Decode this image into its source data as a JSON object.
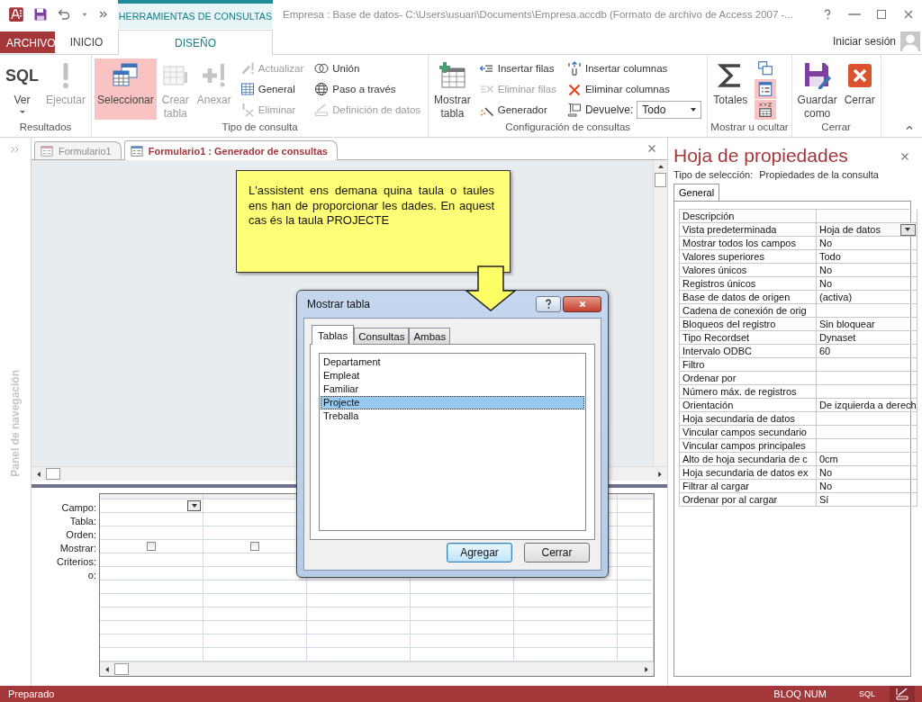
{
  "title_bar": {
    "context_tab": "HERRAMIENTAS DE CONSULTAS",
    "title": "Empresa : Base de datos- C:\\Users\\usuari\\Documents\\Empresa.accdb (Formato de archivo de Access 2007 -..."
  },
  "ribbon_tabs": [
    {
      "label": "ARCHIVO",
      "kind": "file",
      "selected": false
    },
    {
      "label": "INICIO",
      "kind": "tab",
      "selected": false
    },
    {
      "label": "DISEÑO",
      "kind": "tab",
      "selected": true
    }
  ],
  "account": {
    "label": "Iniciar sesión"
  },
  "ribbon": {
    "groups": [
      {
        "label": "Resultados",
        "items": [
          {
            "kind": "split",
            "icon_text": "SQL",
            "label": "Ver",
            "disabled": false,
            "selected": false
          },
          {
            "kind": "large",
            "label": "Ejecutar",
            "disabled": true,
            "selected": false
          }
        ]
      },
      {
        "label": "Tipo de consulta",
        "items": [
          {
            "kind": "large",
            "label": "Seleccionar",
            "disabled": false,
            "selected": true
          },
          {
            "kind": "large",
            "label": "Crear tabla",
            "disabled": true,
            "selected": false
          },
          {
            "kind": "large",
            "label": "Anexar",
            "disabled": true,
            "selected": false
          },
          {
            "kind": "column",
            "buttons": [
              {
                "kind": "small",
                "label": "Actualizar",
                "disabled": true,
                "selected": false
              },
              {
                "kind": "small",
                "label": "General",
                "disabled": false,
                "selected": false
              },
              {
                "kind": "small",
                "label": "Eliminar",
                "disabled": true,
                "selected": false
              }
            ]
          },
          {
            "kind": "column",
            "buttons": [
              {
                "kind": "small",
                "label": "Unión",
                "disabled": false,
                "selected": false
              },
              {
                "kind": "small",
                "label": "Paso a través",
                "disabled": false,
                "selected": false
              },
              {
                "kind": "small",
                "label": "Definición de datos",
                "disabled": true,
                "selected": false
              }
            ]
          }
        ]
      },
      {
        "label": "Configuración de consultas",
        "items": [
          {
            "kind": "large",
            "label": "Mostrar tabla",
            "disabled": false,
            "selected": false
          },
          {
            "kind": "column",
            "buttons": [
              {
                "kind": "small",
                "label": "Insertar filas",
                "disabled": false,
                "selected": false
              },
              {
                "kind": "small",
                "label": "Eliminar filas",
                "disabled": true,
                "selected": false
              },
              {
                "kind": "small",
                "label": "Generador",
                "disabled": false,
                "selected": false
              }
            ]
          },
          {
            "kind": "column",
            "buttons": [
              {
                "kind": "small",
                "label": "Insertar columnas",
                "disabled": false,
                "selected": false
              },
              {
                "kind": "small",
                "label": "Eliminar columnas",
                "disabled": false,
                "selected": false
              },
              {
                "kind": "select",
                "label": "Devuelve:",
                "value": "Todo",
                "disabled": false,
                "selected": false
              }
            ]
          }
        ]
      },
      {
        "label": "Mostrar u ocultar",
        "items": [
          {
            "kind": "large",
            "label": "Totales",
            "disabled": false,
            "selected": false
          },
          {
            "kind": "column",
            "buttons": [
              {
                "kind": "icon",
                "disabled": false,
                "selected": false
              },
              {
                "kind": "icon",
                "disabled": false,
                "selected": true
              },
              {
                "kind": "icon",
                "disabled": false,
                "selected": true
              }
            ]
          }
        ]
      },
      {
        "label": "Cerrar",
        "items": [
          {
            "kind": "large",
            "label": "Guardar como",
            "disabled": false,
            "selected": false
          },
          {
            "kind": "large",
            "label": "Cerrar",
            "disabled": false,
            "selected": false
          }
        ]
      }
    ]
  },
  "navigation_pane": {
    "label": "Panel de navegación"
  },
  "document_tabs": [
    {
      "label": "Formulario1",
      "selected": false
    },
    {
      "label": "Formulario1 : Generador de consultas",
      "selected": true
    }
  ],
  "callout": {
    "text": "L'assistent ens demana quina taula o taules ens han de proporcionar les dades. En aquest cas és la taula PROJECTE"
  },
  "design_grid": {
    "row_labels": [
      "Campo:",
      "Tabla:",
      "Orden:",
      "Mostrar:",
      "Criterios:",
      "o:"
    ],
    "show": [
      {
        "checked": false
      },
      {
        "checked": false
      }
    ]
  },
  "dialog": {
    "title": "Mostrar tabla",
    "tabs": [
      {
        "label": "Tablas",
        "selected": true
      },
      {
        "label": "Consultas",
        "selected": false
      },
      {
        "label": "Ambas",
        "selected": false
      }
    ],
    "items": [
      {
        "label": "Departament",
        "selected": false
      },
      {
        "label": "Empleat",
        "selected": false
      },
      {
        "label": "Familiar",
        "selected": false
      },
      {
        "label": "Projecte",
        "selected": true
      },
      {
        "label": "Treballa",
        "selected": false
      }
    ],
    "buttons": [
      {
        "label": "Agregar",
        "default": true
      },
      {
        "label": "Cerrar",
        "default": false
      }
    ]
  },
  "property_sheet": {
    "title": "Hoja de propiedades",
    "selection_label": "Tipo de selección:",
    "selection_value": "Propiedades de la consulta",
    "tabs": [
      {
        "label": "General",
        "selected": true
      }
    ],
    "rows": [
      {
        "label": "Descripción",
        "value": "",
        "dropdown": false
      },
      {
        "label": "Vista predeterminada",
        "value": "Hoja de datos",
        "dropdown": true
      },
      {
        "label": "Mostrar todos los campos",
        "value": "No",
        "dropdown": false
      },
      {
        "label": "Valores superiores",
        "value": "Todo",
        "dropdown": false
      },
      {
        "label": "Valores únicos",
        "value": "No",
        "dropdown": false
      },
      {
        "label": "Registros únicos",
        "value": "No",
        "dropdown": false
      },
      {
        "label": "Base de datos de origen",
        "value": "(activa)",
        "dropdown": false
      },
      {
        "label": "Cadena de conexión de orig",
        "value": "",
        "dropdown": false
      },
      {
        "label": "Bloqueos del registro",
        "value": "Sin bloquear",
        "dropdown": false
      },
      {
        "label": "Tipo Recordset",
        "value": "Dynaset",
        "dropdown": false
      },
      {
        "label": "Intervalo ODBC",
        "value": "60",
        "dropdown": false
      },
      {
        "label": "Filtro",
        "value": "",
        "dropdown": false
      },
      {
        "label": "Ordenar por",
        "value": "",
        "dropdown": false
      },
      {
        "label": "Número máx. de registros",
        "value": "",
        "dropdown": false
      },
      {
        "label": "Orientación",
        "value": "De izquierda a derech",
        "dropdown": false
      },
      {
        "label": "Hoja secundaria de datos",
        "value": "",
        "dropdown": false
      },
      {
        "label": "Vincular campos secundario",
        "value": "",
        "dropdown": false
      },
      {
        "label": "Vincular campos principales",
        "value": "",
        "dropdown": false
      },
      {
        "label": "Alto de hoja secundaria de c",
        "value": "0cm",
        "dropdown": false
      },
      {
        "label": "Hoja secundaria de datos ex",
        "value": "No",
        "dropdown": false
      },
      {
        "label": "Filtrar al cargar",
        "value": "No",
        "dropdown": false
      },
      {
        "label": "Ordenar por al cargar",
        "value": "Sí",
        "dropdown": false
      }
    ]
  },
  "status_bar": {
    "text": "Preparado",
    "indicator": "BLOQ NUM",
    "views": [
      {
        "label": "SQL",
        "selected": false
      },
      {
        "selected": true
      }
    ]
  }
}
